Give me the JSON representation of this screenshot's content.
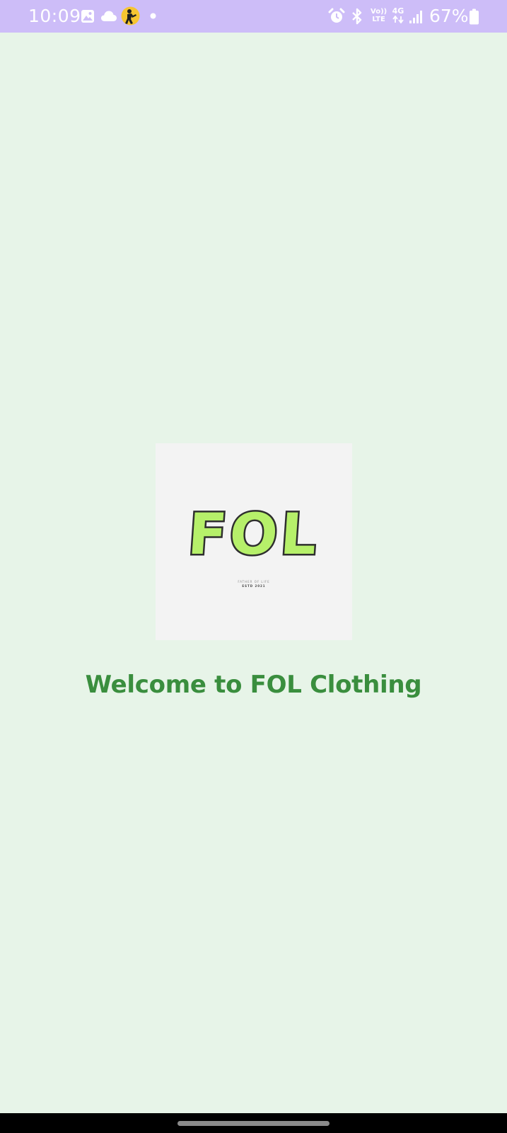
{
  "status_bar": {
    "time": "10:09",
    "battery_percent": "67%",
    "network_type": "4G",
    "volte_label_top": "Vo))",
    "volte_label_bottom": "LTE",
    "icons": [
      "gallery-icon",
      "cloud-icon",
      "app-notification-icon",
      "dot-icon",
      "alarm-icon",
      "bluetooth-icon",
      "volte-icon",
      "4g-data-icon",
      "signal-icon",
      "battery-icon"
    ],
    "background_color": "#cdbdf8"
  },
  "logo": {
    "brand_text": "FOL",
    "tagline": "FATHER OF LIFE",
    "established": "ESTD 2021",
    "fill_color": "#b6f06a"
  },
  "main": {
    "welcome_text": "Welcome to FOL Clothing",
    "text_color": "#3a8e3e",
    "background_color": "#e7f4e8"
  },
  "nav_bar": {
    "handle": "home-handle"
  }
}
